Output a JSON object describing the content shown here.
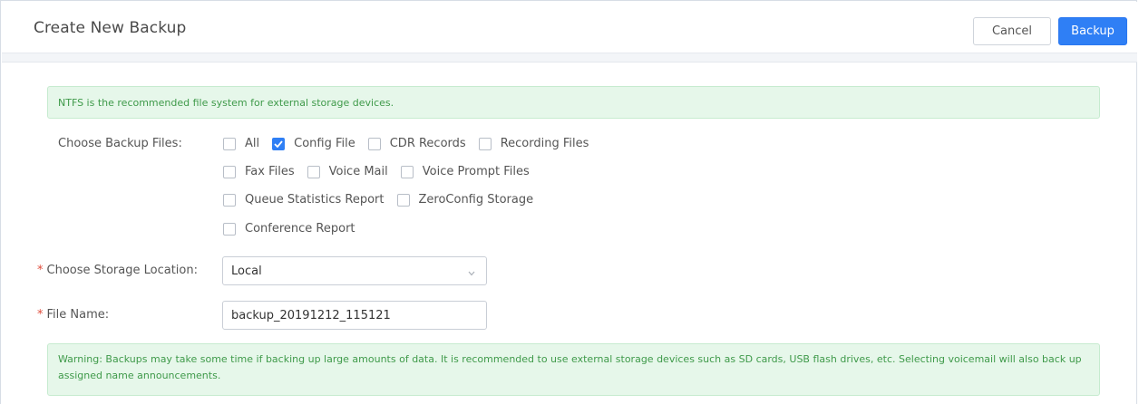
{
  "header": {
    "title": "Create New Backup",
    "cancel_label": "Cancel",
    "backup_label": "Backup"
  },
  "notice_top": "NTFS is the recommended file system for external storage devices.",
  "backup_files": {
    "label": "Choose Backup Files:",
    "rows": [
      [
        {
          "label": "All",
          "checked": false
        },
        {
          "label": "Config File",
          "checked": true
        },
        {
          "label": "CDR Records",
          "checked": false
        },
        {
          "label": "Recording Files",
          "checked": false
        }
      ],
      [
        {
          "label": "Fax Files",
          "checked": false
        },
        {
          "label": "Voice Mail",
          "checked": false
        },
        {
          "label": "Voice Prompt Files",
          "checked": false
        }
      ],
      [
        {
          "label": "Queue Statistics Report",
          "checked": false
        },
        {
          "label": "ZeroConfig Storage",
          "checked": false
        }
      ],
      [
        {
          "label": "Conference Report",
          "checked": false
        }
      ]
    ]
  },
  "storage_location": {
    "required_mark": "*",
    "label": "Choose Storage Location:",
    "value": "Local"
  },
  "file_name": {
    "required_mark": "*",
    "label": "File Name:",
    "value": "backup_20191212_115121"
  },
  "notice_bottom": "Warning: Backups may take some time if backing up large amounts of data. It is recommended to use external storage devices such as SD cards, USB flash drives, etc. Selecting voicemail will also back up assigned name announcements.",
  "colors": {
    "primary": "#2f7ff5",
    "alert_bg": "#e6f7ea",
    "alert_text": "#3f9a4a",
    "required": "#e04b3a"
  }
}
